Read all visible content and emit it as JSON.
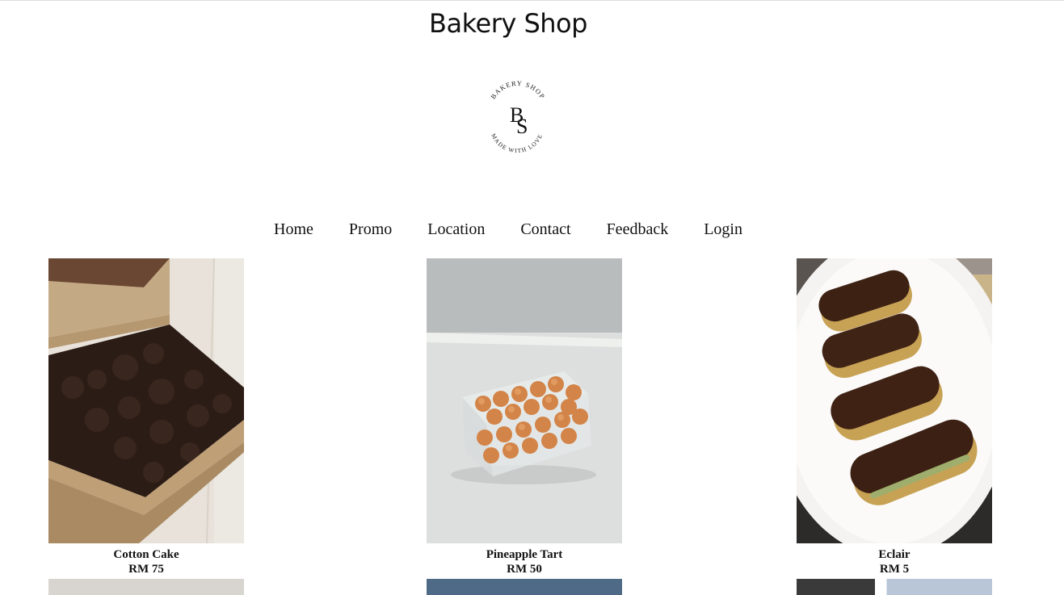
{
  "header": {
    "title": "Bakery Shop"
  },
  "logo": {
    "top_text": "BAKERY SHOP",
    "monogram_b": "B",
    "monogram_s": "S",
    "bottom_text": "MADE WITH LOVE"
  },
  "nav": {
    "items": [
      {
        "label": "Home"
      },
      {
        "label": "Promo"
      },
      {
        "label": "Location"
      },
      {
        "label": "Contact"
      },
      {
        "label": "Feedback"
      },
      {
        "label": "Login"
      }
    ]
  },
  "products": [
    {
      "name": "Cotton Cake",
      "price": "RM 75"
    },
    {
      "name": "Pineapple Tart",
      "price": "RM 50"
    },
    {
      "name": "Eclair",
      "price": "RM 5"
    }
  ],
  "colors": {
    "text": "#111111",
    "background": "#ffffff"
  }
}
